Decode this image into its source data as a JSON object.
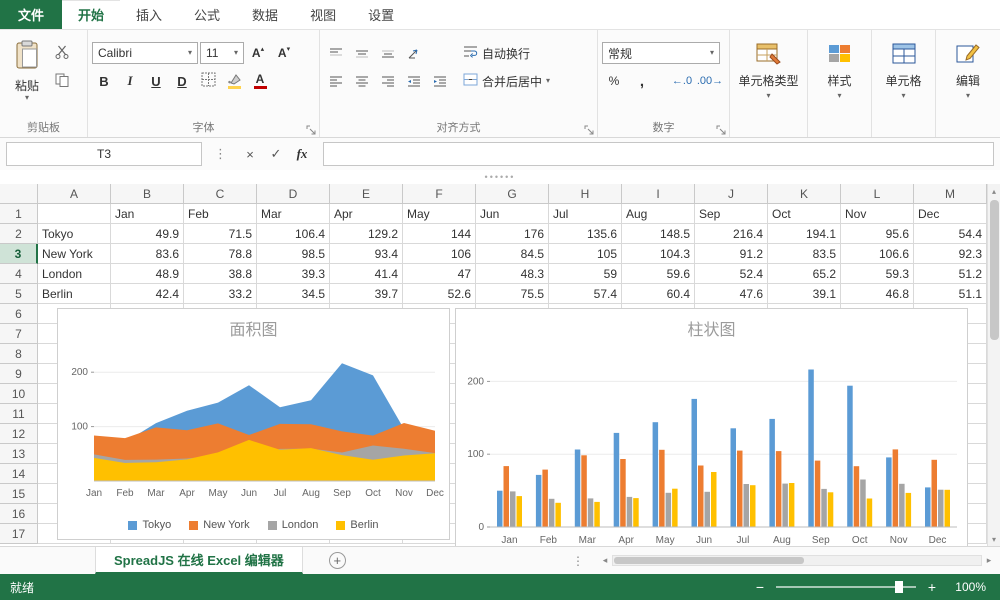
{
  "menu": {
    "file": "文件",
    "tabs": [
      {
        "label": "开始",
        "active": true
      },
      {
        "label": "插入",
        "active": false
      },
      {
        "label": "公式",
        "active": false
      },
      {
        "label": "数据",
        "active": false
      },
      {
        "label": "视图",
        "active": false
      },
      {
        "label": "设置",
        "active": false
      }
    ]
  },
  "ribbon": {
    "clipboard": {
      "paste_label": "粘贴",
      "group_label": "剪贴板"
    },
    "font": {
      "family": "Calibri",
      "size": "11",
      "bold": "B",
      "italic": "I",
      "underline": "U",
      "double_underline": "D",
      "color_letter": "A",
      "grow_letter": "A",
      "shrink_letter": "A",
      "group_label": "字体"
    },
    "alignment": {
      "wrap_label": "自动换行",
      "merge_label": "合并后居中",
      "group_label": "对齐方式"
    },
    "number": {
      "format": "常规",
      "percent": "%",
      "comma": ",",
      "inc_decimal": "←.0",
      "dec_decimal": ".00→",
      "group_label": "数字"
    },
    "big_buttons": [
      {
        "label": "单元格类型"
      },
      {
        "label": "样式"
      },
      {
        "label": "单元格"
      },
      {
        "label": "编辑"
      }
    ]
  },
  "formula_bar": {
    "name_box": "T3",
    "fx_label": "fx",
    "formula": ""
  },
  "grid": {
    "col_headers": [
      "A",
      "B",
      "C",
      "D",
      "E",
      "F",
      "G",
      "H",
      "I",
      "J",
      "K",
      "L",
      "M"
    ],
    "row_count": 17,
    "selected_row": 3,
    "rows": [
      {
        "row": 1,
        "cells": [
          "",
          "Jan",
          "Feb",
          "Mar",
          "Apr",
          "May",
          "Jun",
          "Jul",
          "Aug",
          "Sep",
          "Oct",
          "Nov",
          "Dec"
        ]
      },
      {
        "row": 2,
        "cells": [
          "Tokyo",
          49.9,
          71.5,
          106.4,
          129.2,
          144,
          176,
          135.6,
          148.5,
          216.4,
          194.1,
          95.6,
          54.4
        ]
      },
      {
        "row": 3,
        "cells": [
          "New York",
          83.6,
          78.8,
          98.5,
          93.4,
          106,
          84.5,
          105,
          104.3,
          91.2,
          83.5,
          106.6,
          92.3
        ]
      },
      {
        "row": 4,
        "cells": [
          "London",
          48.9,
          38.8,
          39.3,
          41.4,
          47,
          48.3,
          59,
          59.6,
          52.4,
          65.2,
          59.3,
          51.2
        ]
      },
      {
        "row": 5,
        "cells": [
          "Berlin",
          42.4,
          33.2,
          34.5,
          39.7,
          52.6,
          75.5,
          57.4,
          60.4,
          47.6,
          39.1,
          46.8,
          51.1
        ]
      }
    ]
  },
  "chart_data": [
    {
      "type": "area",
      "title": "面积图",
      "categories": [
        "Jan",
        "Feb",
        "Mar",
        "Apr",
        "May",
        "Jun",
        "Jul",
        "Aug",
        "Sep",
        "Oct",
        "Nov",
        "Dec"
      ],
      "series": [
        {
          "name": "Tokyo",
          "color": "#5B9BD5",
          "values": [
            49.9,
            71.5,
            106.4,
            129.2,
            144,
            176,
            135.6,
            148.5,
            216.4,
            194.1,
            95.6,
            54.4
          ]
        },
        {
          "name": "New York",
          "color": "#ED7D31",
          "values": [
            83.6,
            78.8,
            98.5,
            93.4,
            106,
            84.5,
            105,
            104.3,
            91.2,
            83.5,
            106.6,
            92.3
          ]
        },
        {
          "name": "London",
          "color": "#A5A5A5",
          "values": [
            48.9,
            38.8,
            39.3,
            41.4,
            47,
            48.3,
            59,
            59.6,
            52.4,
            65.2,
            59.3,
            51.2
          ]
        },
        {
          "name": "Berlin",
          "color": "#FFC000",
          "values": [
            42.4,
            33.2,
            34.5,
            39.7,
            52.6,
            75.5,
            57.4,
            60.4,
            47.6,
            39.1,
            46.8,
            51.1
          ]
        }
      ],
      "stacked": false,
      "ylim": [
        0,
        250
      ],
      "yticks": [
        100,
        200
      ],
      "grid": true,
      "legend": "bottom"
    },
    {
      "type": "bar",
      "title": "柱状图",
      "categories": [
        "Jan",
        "Feb",
        "Mar",
        "Apr",
        "May",
        "Jun",
        "Jul",
        "Aug",
        "Sep",
        "Oct",
        "Nov",
        "Dec"
      ],
      "series": [
        {
          "name": "Tokyo",
          "color": "#5B9BD5",
          "values": [
            49.9,
            71.5,
            106.4,
            129.2,
            144,
            176,
            135.6,
            148.5,
            216.4,
            194.1,
            95.6,
            54.4
          ]
        },
        {
          "name": "New York",
          "color": "#ED7D31",
          "values": [
            83.6,
            78.8,
            98.5,
            93.4,
            106,
            84.5,
            105,
            104.3,
            91.2,
            83.5,
            106.6,
            92.3
          ]
        },
        {
          "name": "London",
          "color": "#A5A5A5",
          "values": [
            48.9,
            38.8,
            39.3,
            41.4,
            47,
            48.3,
            59,
            59.6,
            52.4,
            65.2,
            59.3,
            51.2
          ]
        },
        {
          "name": "Berlin",
          "color": "#FFC000",
          "values": [
            42.4,
            33.2,
            34.5,
            39.7,
            52.6,
            75.5,
            57.4,
            60.4,
            47.6,
            39.1,
            46.8,
            51.1
          ]
        }
      ],
      "ylim": [
        0,
        250
      ],
      "yticks": [
        0,
        100,
        200
      ],
      "grid": true,
      "legend": "none"
    }
  ],
  "tab_bar": {
    "sheet_label": "SpreadJS 在线 Excel 编辑器"
  },
  "status_bar": {
    "status": "就绪",
    "zoom": "100%",
    "accent_color": "#217346"
  }
}
